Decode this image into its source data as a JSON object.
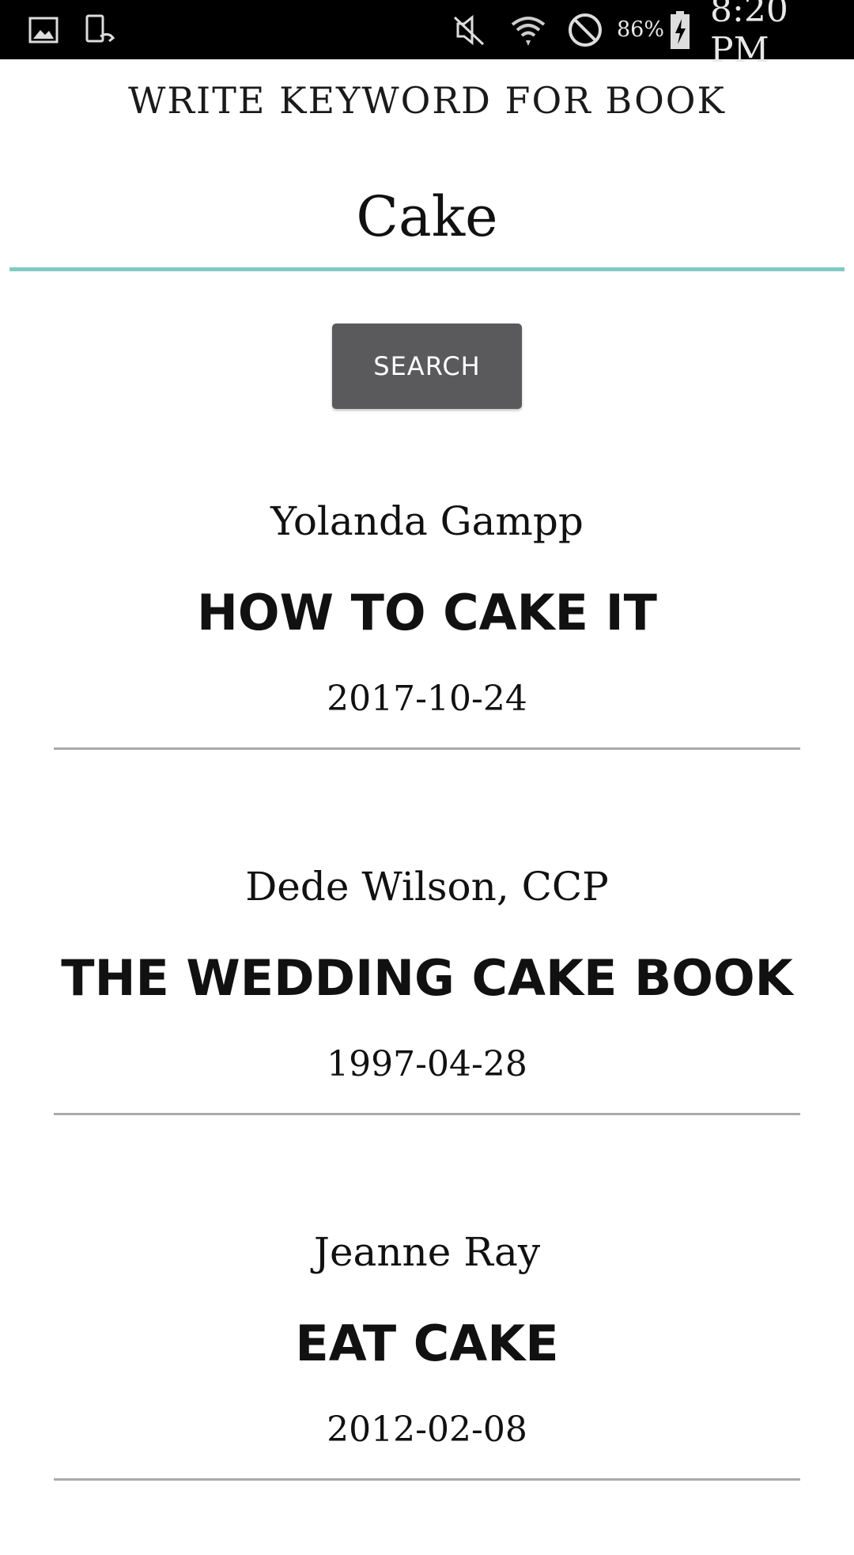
{
  "status_bar": {
    "battery": "86%",
    "time": "8:20 PM",
    "icons": [
      "gallery-icon",
      "screen-mirroring-icon",
      "mute-icon",
      "wifi-icon",
      "no-disturb-icon",
      "battery-charging-icon"
    ]
  },
  "header": {
    "title": "WRITE KEYWORD FOR BOOK"
  },
  "search": {
    "value": "Cake",
    "button_label": "SEARCH"
  },
  "colors": {
    "accent": "#80cbc4",
    "button": "#5a5a5c"
  },
  "results": [
    {
      "author": "Yolanda Gampp",
      "title": "HOW TO CAKE IT",
      "date": "2017-10-24"
    },
    {
      "author": "Dede Wilson, CCP",
      "title": "THE WEDDING CAKE BOOK",
      "date": "1997-04-28"
    },
    {
      "author": "Jeanne Ray",
      "title": "EAT CAKE",
      "date": "2012-02-08"
    }
  ]
}
